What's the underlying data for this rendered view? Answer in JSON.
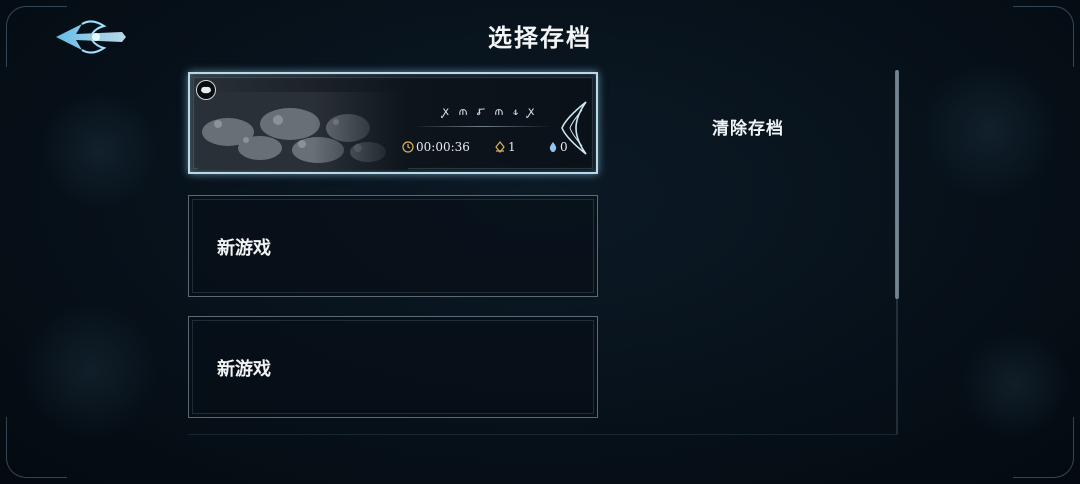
{
  "header": {
    "title": "选择存档",
    "back_icon": "ornate-back-arrow-icon"
  },
  "slots": [
    {
      "state": "saved",
      "rune_name": "ꭙ ⫙ ꭊ ⫙ ꮞ ꭙ",
      "play_time": "00:00:36",
      "geo": "1",
      "essence": "0",
      "accent": "#b9d8e8"
    },
    {
      "state": "empty",
      "label": "新游戏"
    },
    {
      "state": "empty",
      "label": "新游戏"
    }
  ],
  "actions": {
    "clear_label": "清除存档"
  },
  "scrollbar": {
    "visible_fraction": 0.63
  }
}
